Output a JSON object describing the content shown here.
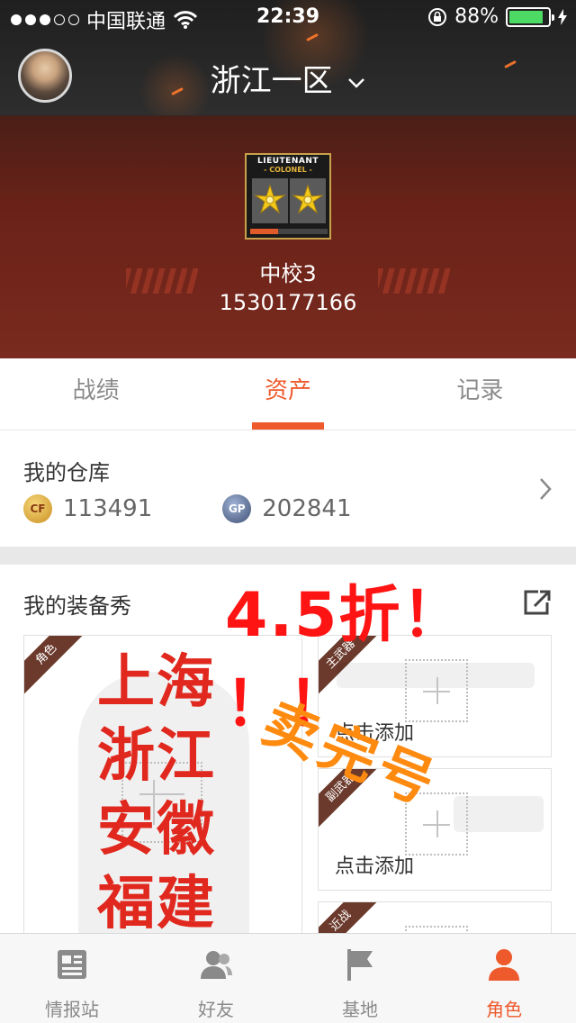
{
  "status_bar": {
    "carrier": "中国联通",
    "time": "22:39",
    "battery": "88%",
    "battery_level": 0.88
  },
  "header": {
    "server": "浙江一区",
    "rank_badge": {
      "line1": "LIEUTENANT",
      "line2": "- COLONEL -"
    },
    "rank_name": "中校3",
    "user_id": "1530177166"
  },
  "tabs": [
    {
      "label": "战绩",
      "active": false
    },
    {
      "label": "资产",
      "active": true
    },
    {
      "label": "记录",
      "active": false
    }
  ],
  "warehouse": {
    "title": "我的仓库",
    "cf_points": "113491",
    "gp_points": "202841",
    "gp_icon_text": "GP"
  },
  "equipment": {
    "title": "我的装备秀",
    "promo_overlay": "4.5折！ ！！",
    "cards": [
      {
        "tag": "角色"
      },
      {
        "tag": "主武器",
        "add_label": "点击添加"
      },
      {
        "tag": "副武器",
        "add_label": "点击添加"
      },
      {
        "tag": "近战"
      }
    ],
    "overlay_regions": [
      "上海",
      "浙江",
      "安徽",
      "福建"
    ],
    "overlay_handwriting": "卖完号"
  },
  "bottom_nav": [
    {
      "label": "情报站",
      "icon": "news-icon",
      "active": false
    },
    {
      "label": "好友",
      "icon": "friends-icon",
      "active": false
    },
    {
      "label": "基地",
      "icon": "flag-icon",
      "active": false
    },
    {
      "label": "角色",
      "icon": "person-icon",
      "active": true
    }
  ],
  "colors": {
    "accent": "#ee5a2c",
    "promo_red": "#ff1414",
    "promo_orange": "#ff8a10"
  }
}
